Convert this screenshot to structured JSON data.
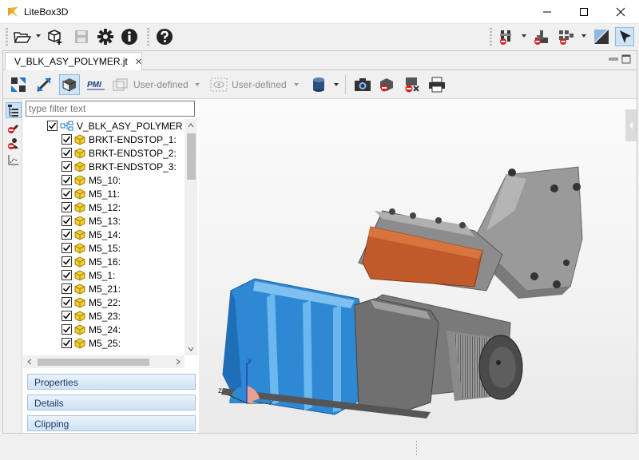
{
  "window": {
    "title": "LiteBox3D"
  },
  "tab": {
    "label": "V_BLK_ASY_POLYMER.jt"
  },
  "view_toolbar": {
    "view_preset_1": "User-defined",
    "view_preset_2": "User-defined",
    "pmi_label": "PMI"
  },
  "tree": {
    "filter_placeholder": "type filter text",
    "root": "V_BLK_ASY_POLYMER",
    "items": [
      "BRKT-ENDSTOP_1:",
      "BRKT-ENDSTOP_2:",
      "BRKT-ENDSTOP_3:",
      "M5_10:",
      "M5_11:",
      "M5_12:",
      "M5_13:",
      "M5_14:",
      "M5_15:",
      "M5_16:",
      "M5_1:",
      "M5_21:",
      "M5_22:",
      "M5_23:",
      "M5_24:",
      "M5_25:"
    ]
  },
  "panels": {
    "properties": "Properties",
    "details": "Details",
    "clipping": "Clipping"
  },
  "axes": {
    "x": "x",
    "y": "y",
    "z": "z"
  },
  "colors": {
    "accent_blue": "#1e78d0",
    "part_orange": "#c05a2a",
    "part_blue": "#3a9be0"
  }
}
